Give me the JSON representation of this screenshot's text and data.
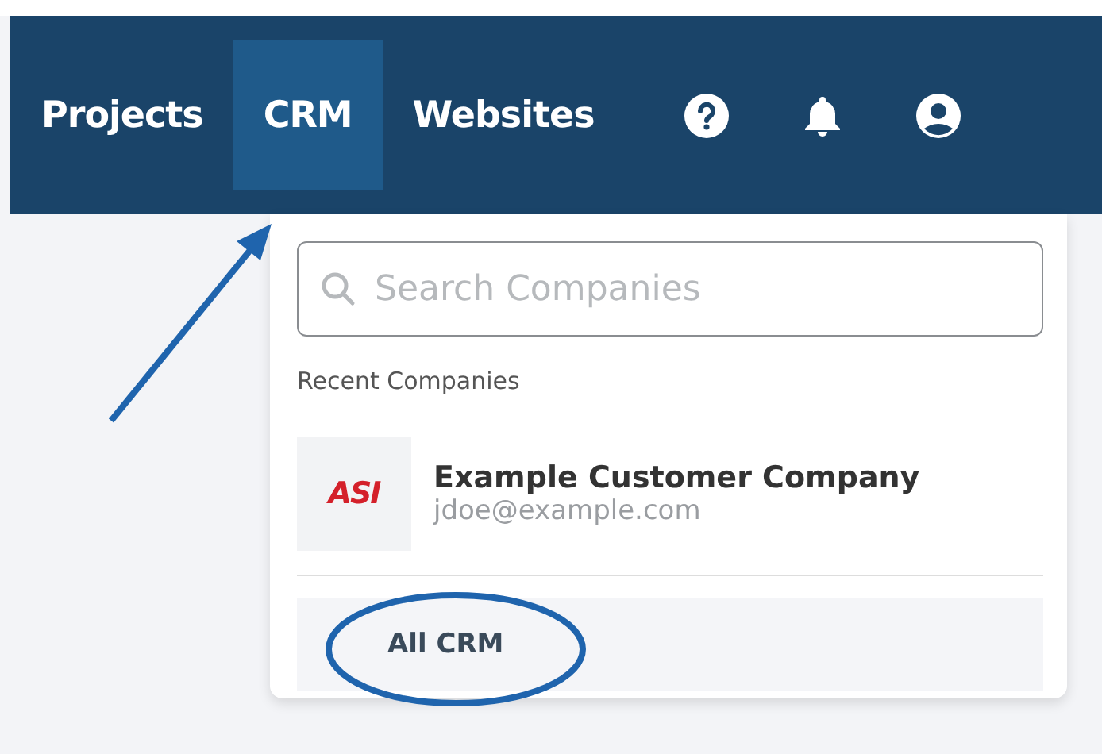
{
  "nav": {
    "tabs": [
      {
        "label": "Projects",
        "selected": false
      },
      {
        "label": "CRM",
        "selected": true
      },
      {
        "label": "Websites",
        "selected": false
      }
    ]
  },
  "dropdown": {
    "search": {
      "placeholder": "Search Companies"
    },
    "section_title": "Recent Companies",
    "companies": [
      {
        "logo_text": "ASI",
        "name": "Example Customer Company",
        "email": "jdoe@example.com"
      }
    ],
    "footer_link": "All CRM"
  }
}
